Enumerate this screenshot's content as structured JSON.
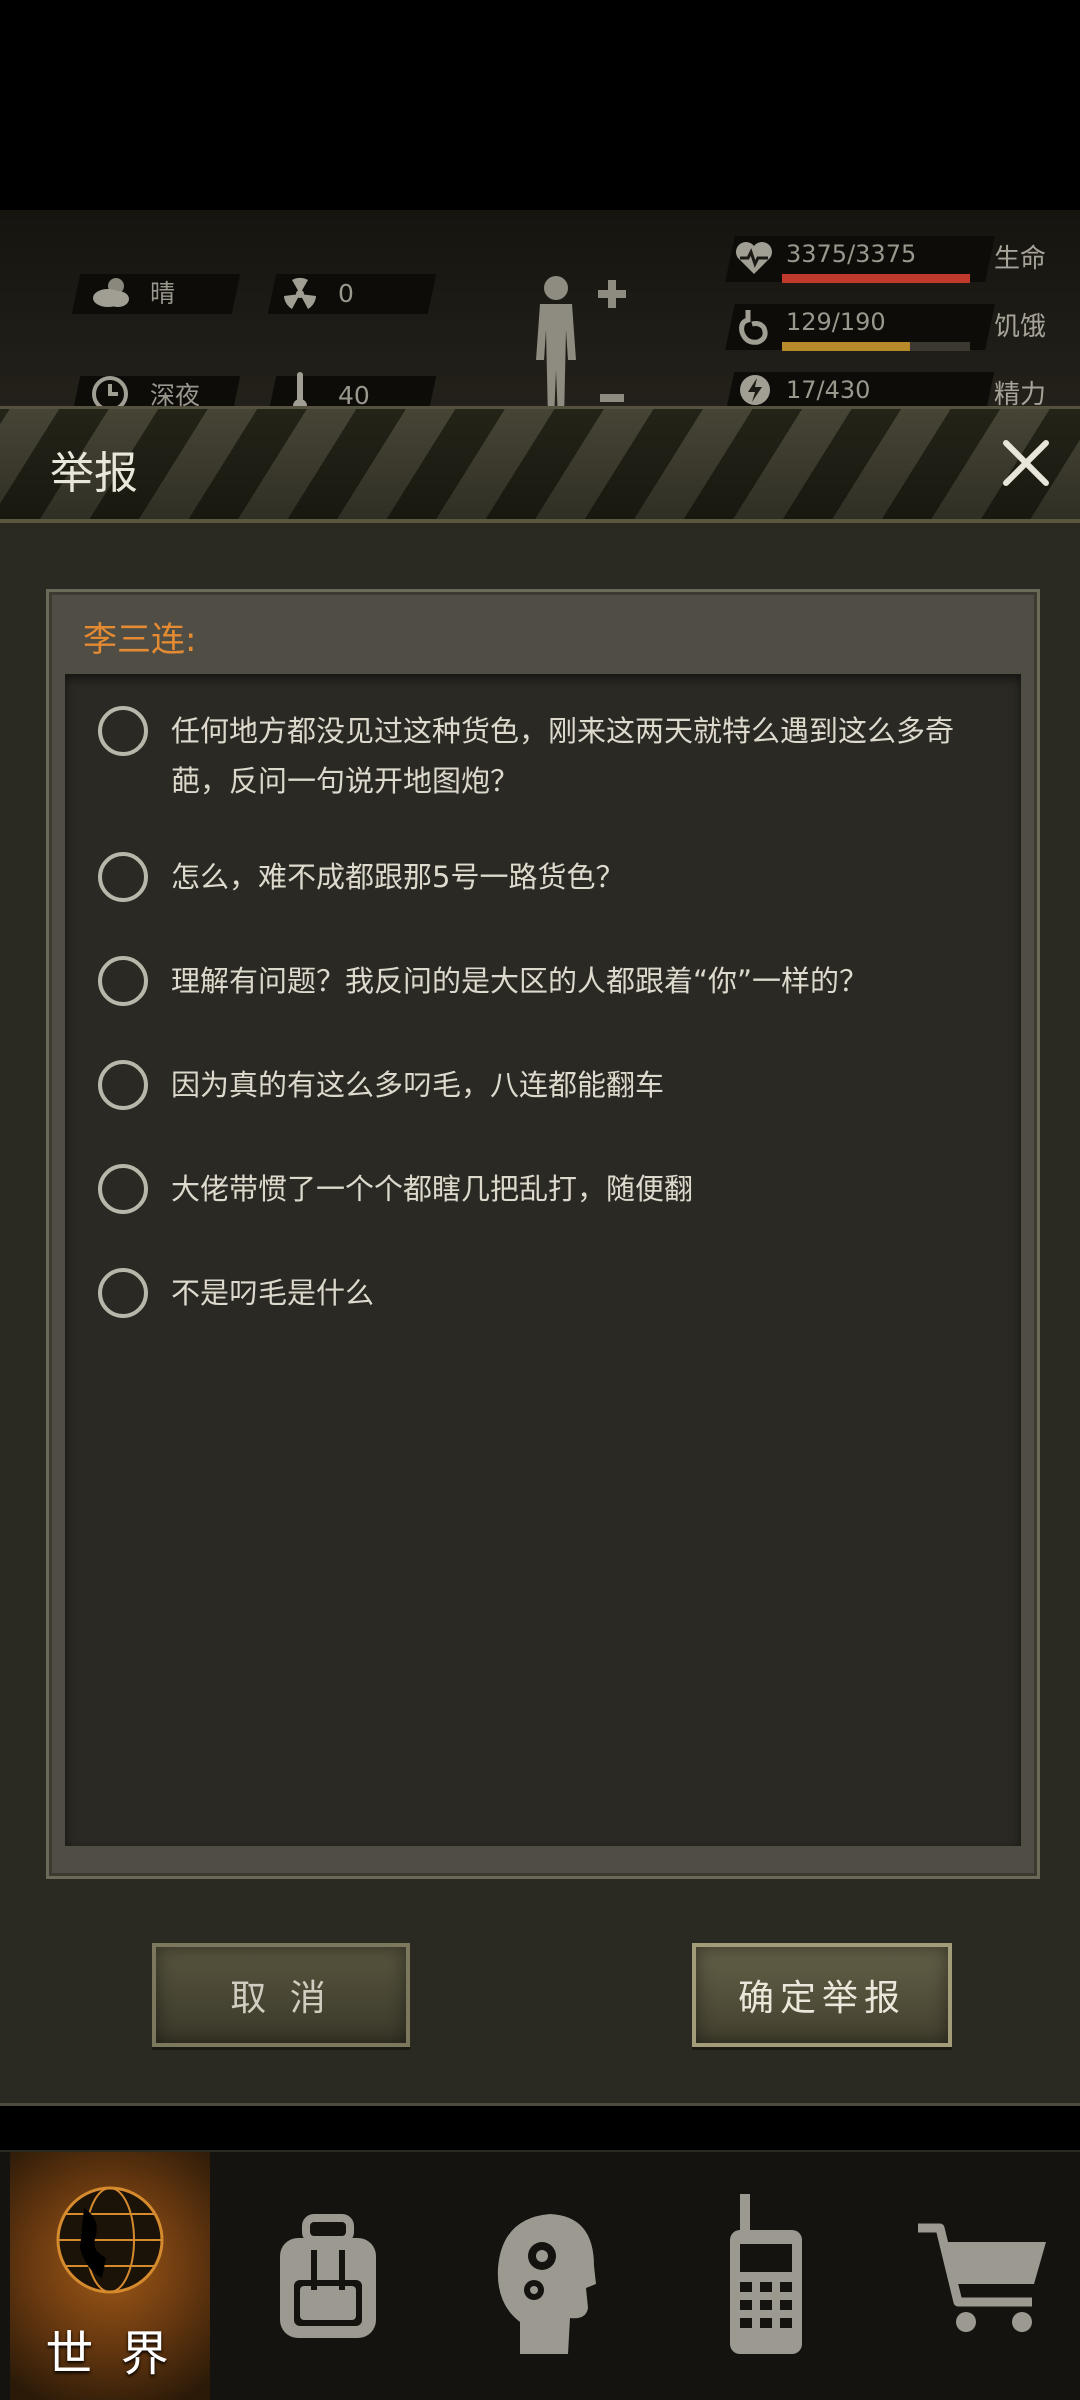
{
  "hud": {
    "weather": "晴",
    "radiation": "0",
    "time_of_day": "深夜",
    "temperature": "40",
    "health": {
      "value": "3375/3375",
      "label": "生命",
      "fraction": 1.0,
      "color": "#c0392b"
    },
    "hunger": {
      "value": "129/190",
      "label": "饥饿",
      "fraction": 0.68,
      "color": "#b88a2a"
    },
    "energy": {
      "value": "17/430",
      "label": "精力"
    }
  },
  "dialog": {
    "title": "举报",
    "target_label": "李三连:",
    "options": [
      {
        "text": "任何地方都没见过这种货色，刚来这两天就特么遇到这么多奇葩，反问一句说开地图炮？"
      },
      {
        "text": "怎么，难不成都跟那5号一路货色？"
      },
      {
        "text": "理解有问题？我反问的是大区的人都跟着“你”一样的？"
      },
      {
        "text": "因为真的有这么多叼毛，八连都能翻车"
      },
      {
        "text": "大佬带惯了一个个都瞎几把乱打，随便翻"
      },
      {
        "text": "不是叼毛是什么"
      }
    ],
    "cancel_label": "取 消",
    "confirm_label": "确定举报"
  },
  "nav": {
    "items": [
      {
        "name": "world",
        "label": "世 界",
        "active": true
      },
      {
        "name": "backpack",
        "label": ""
      },
      {
        "name": "skills",
        "label": ""
      },
      {
        "name": "radio",
        "label": ""
      },
      {
        "name": "shop",
        "label": ""
      }
    ]
  }
}
